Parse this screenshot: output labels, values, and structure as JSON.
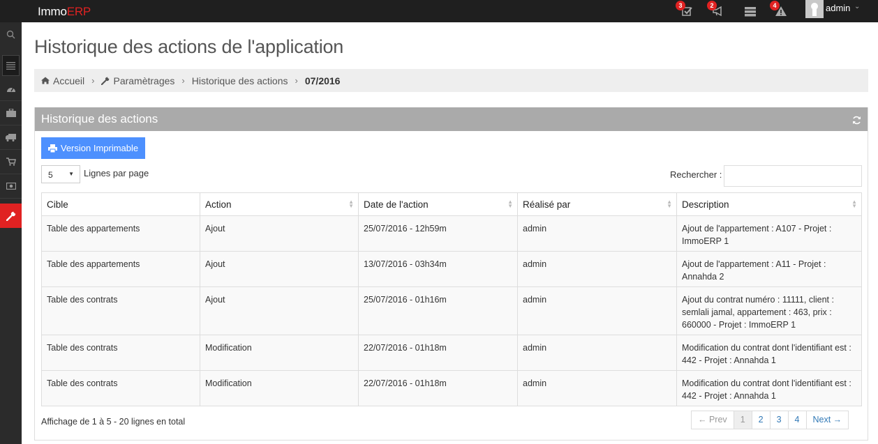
{
  "app": {
    "brand_main": "Immo",
    "brand_accent": "ERP",
    "user": "admin",
    "notifications": [
      {
        "icon": "tasks-icon",
        "count": "3"
      },
      {
        "icon": "bullhorn-icon",
        "count": "2"
      },
      {
        "icon": "server-icon",
        "count": ""
      },
      {
        "icon": "warning-icon",
        "count": "4"
      }
    ]
  },
  "colors": {
    "accent": "#e02222",
    "topbar": "#1f1f1f",
    "sidebar": "#2b2b2b",
    "button": "#4d90fe",
    "portlet_header": "#aaaaaa"
  },
  "sidebar": {
    "items": [
      {
        "icon": "search-icon"
      },
      {
        "icon": "menu-toggle-icon"
      },
      {
        "icon": "dashboard-icon"
      },
      {
        "icon": "briefcase-icon"
      },
      {
        "icon": "truck-icon"
      },
      {
        "icon": "cart-icon"
      },
      {
        "icon": "money-icon"
      },
      {
        "icon": "wrench-icon"
      }
    ]
  },
  "page": {
    "title": "Historique des actions de l'application"
  },
  "breadcrumb": {
    "home": "Accueil",
    "settings": "Paramètrages",
    "history": "Historique des actions",
    "current": "07/2016"
  },
  "portlet": {
    "title": "Historique des actions",
    "print_label": "Version Imprimable",
    "page_size": "5",
    "page_size_label": "Lignes par page",
    "search_label": "Rechercher :"
  },
  "table": {
    "columns": [
      "Cible",
      "Action",
      "Date de l'action",
      "Réalisé par",
      "Description"
    ],
    "rows": [
      [
        "Table des appartements",
        "Ajout",
        "25/07/2016 - 12h59m",
        "admin",
        "Ajout de l'appartement : A107 - Projet : ImmoERP 1"
      ],
      [
        "Table des appartements",
        "Ajout",
        "13/07/2016 - 03h34m",
        "admin",
        "Ajout de l'appartement : A11 - Projet : Annahda 2"
      ],
      [
        "Table des contrats",
        "Ajout",
        "25/07/2016 - 01h16m",
        "admin",
        "Ajout du contrat numéro : 11111, client : semlali jamal, appartement : 463, prix : 660000 - Projet : ImmoERP 1"
      ],
      [
        "Table des contrats",
        "Modification",
        "22/07/2016 - 01h18m",
        "admin",
        "Modification du contrat dont l'identifiant est : 442 - Projet : Annahda 1"
      ],
      [
        "Table des contrats",
        "Modification",
        "22/07/2016 - 01h18m",
        "admin",
        "Modification du contrat dont l'identifiant est : 442 - Projet : Annahda 1"
      ]
    ]
  },
  "footer": {
    "info": "Affichage de 1 à 5 - 20 lignes en total",
    "prev": "← Prev",
    "pages": [
      "1",
      "2",
      "3",
      "4"
    ],
    "next": "Next →"
  }
}
